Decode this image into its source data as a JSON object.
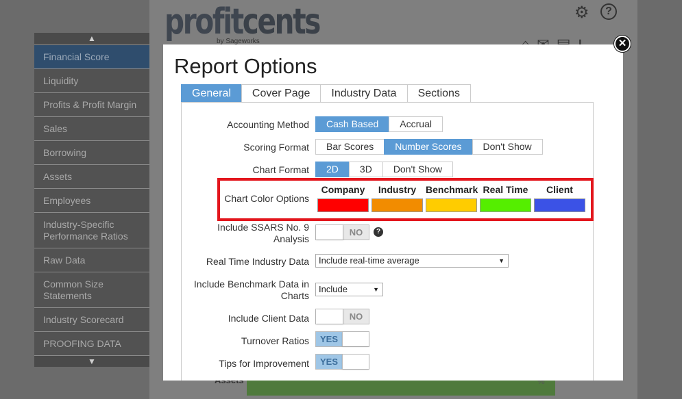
{
  "background": {
    "logo_main": "profit",
    "logo_cents": "cents",
    "logo_sub": "by Sageworks",
    "gear_icon": "⚙",
    "help_icon": "?",
    "toolbar_icons": "⌂✉▤⭳",
    "bg_label": "Assets",
    "bg_pct": "%"
  },
  "sidebar": {
    "up_arrow": "▲",
    "down_arrow": "▼",
    "items": [
      {
        "label": "Financial Score",
        "active": true
      },
      {
        "label": "Liquidity"
      },
      {
        "label": "Profits & Profit Margin"
      },
      {
        "label": "Sales"
      },
      {
        "label": "Borrowing"
      },
      {
        "label": "Assets"
      },
      {
        "label": "Employees"
      },
      {
        "label": "Industry-Specific Performance Ratios"
      },
      {
        "label": "Raw Data"
      },
      {
        "label": "Common Size Statements"
      },
      {
        "label": "Industry Scorecard"
      },
      {
        "label": "PROOFING DATA"
      }
    ]
  },
  "modal": {
    "title": "Report Options",
    "close_icon": "✕",
    "tabs": [
      "General",
      "Cover Page",
      "Industry Data",
      "Sections"
    ],
    "accounting_method": {
      "label": "Accounting Method",
      "options": [
        "Cash Based",
        "Accrual"
      ],
      "selected": "Cash Based"
    },
    "scoring_format": {
      "label": "Scoring Format",
      "options": [
        "Bar Scores",
        "Number Scores",
        "Don't Show"
      ],
      "selected": "Number Scores"
    },
    "chart_format": {
      "label": "Chart Format",
      "options": [
        "2D",
        "3D",
        "Don't Show"
      ],
      "selected": "2D"
    },
    "chart_colors": {
      "label": "Chart Color Options",
      "swatches": [
        {
          "name": "Company",
          "color": "#ff0000"
        },
        {
          "name": "Industry",
          "color": "#f28c00"
        },
        {
          "name": "Benchmark",
          "color": "#ffcc00"
        },
        {
          "name": "Real Time",
          "color": "#55ee00"
        },
        {
          "name": "Client",
          "color": "#3b52e6"
        }
      ]
    },
    "ssars": {
      "label": "Include SSARS No. 9 Analysis",
      "value": "NO",
      "help": "?"
    },
    "real_time": {
      "label": "Real Time Industry Data",
      "value": "Include real-time average",
      "caret": "▼"
    },
    "benchmark": {
      "label": "Include Benchmark Data in Charts",
      "value": "Include",
      "caret": "▼"
    },
    "client_data": {
      "label": "Include Client Data",
      "value": "NO"
    },
    "turnover": {
      "label": "Turnover Ratios",
      "value": "YES"
    },
    "tips": {
      "label": "Tips for Improvement",
      "value": "YES"
    }
  },
  "colors": {
    "accent": "#5b9bd5",
    "highlight_box": "#e3161d"
  }
}
